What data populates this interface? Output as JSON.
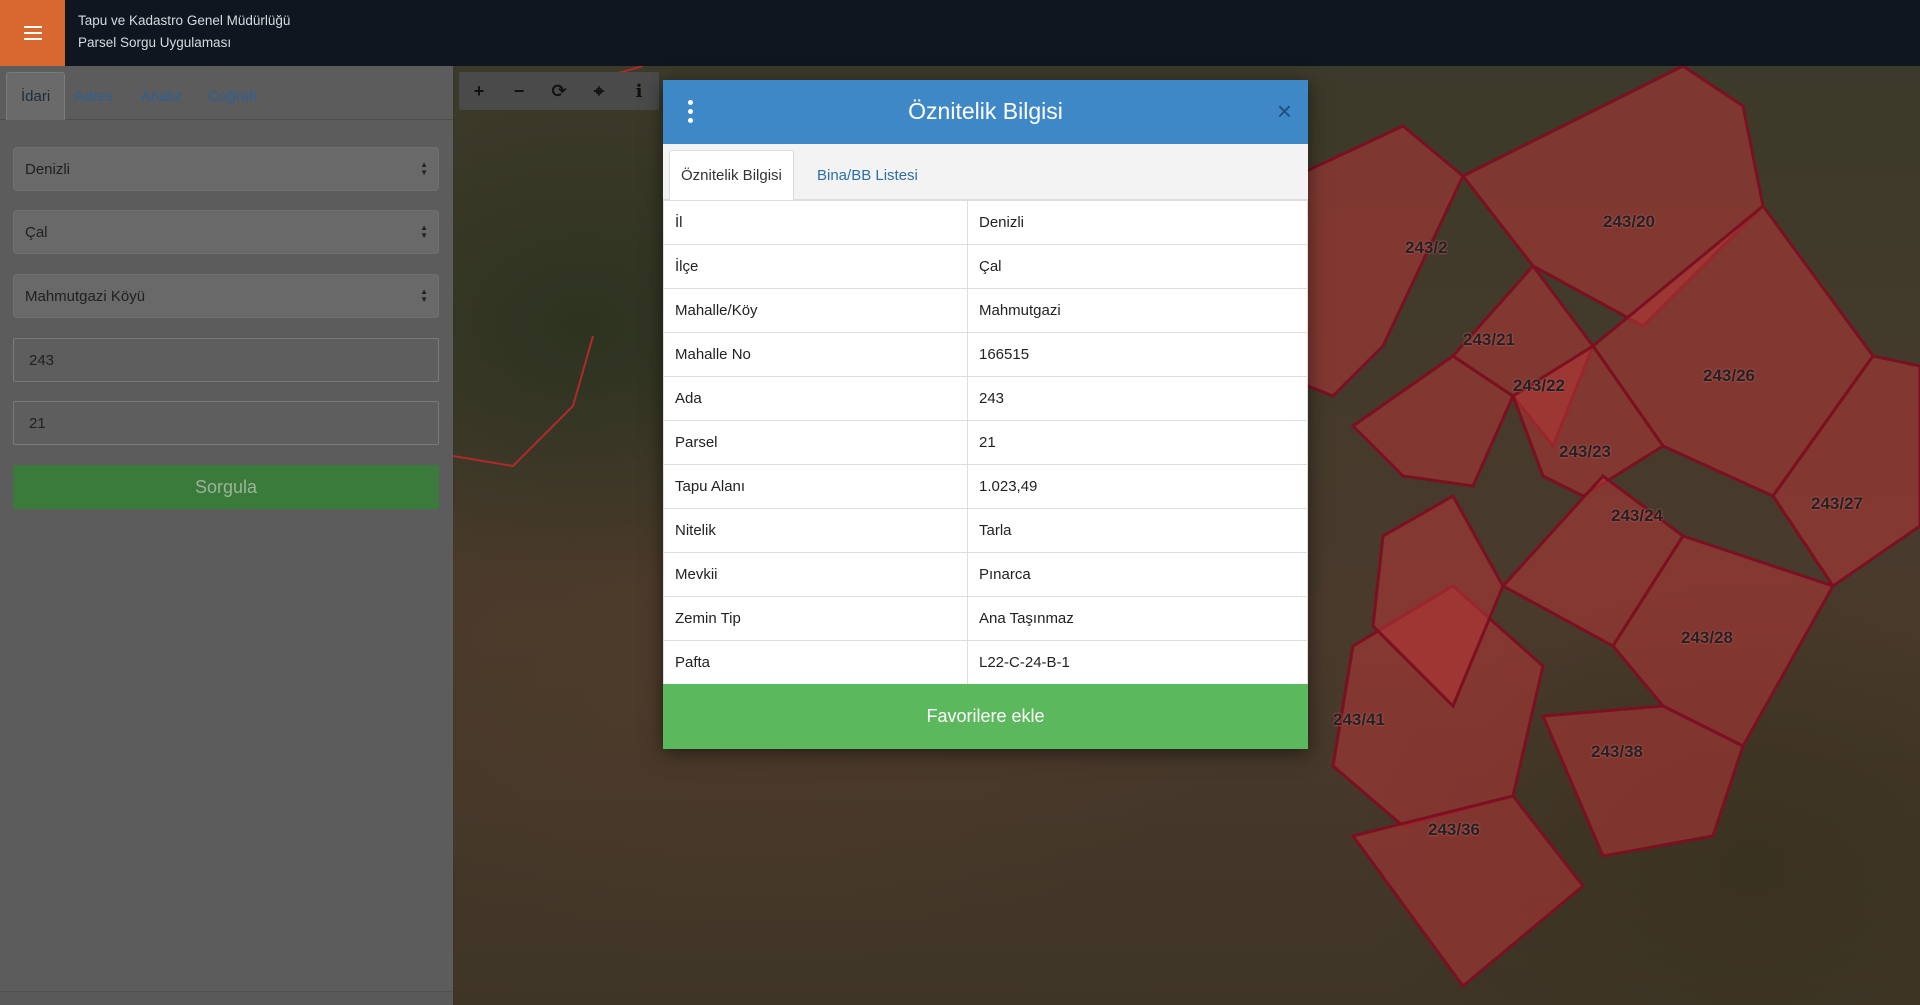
{
  "header": {
    "org_name": "Tapu ve Kadastro Genel Müdürlüğü",
    "app_name": "Parsel Sorgu Uygulaması",
    "menu_icon": "hamburger-icon",
    "accent_color": "#d9682e"
  },
  "sidebar": {
    "tabs": [
      {
        "label": "İdari",
        "active": true
      },
      {
        "label": "Adres",
        "active": false
      },
      {
        "label": "Analiz",
        "active": false
      },
      {
        "label": "Coğrafi",
        "active": false
      }
    ],
    "province_select": "Denizli",
    "district_select": "Çal",
    "neighborhood_select": "Mahmutgazi Köyü",
    "block_input": "243",
    "parcel_input": "21",
    "query_button": "Sorgula"
  },
  "map": {
    "toolbar": [
      "zoom-in-icon",
      "zoom-out-icon",
      "refresh-icon",
      "locate-icon",
      "info-icon"
    ],
    "parcel_labels": [
      "243/2",
      "243/20",
      "243/21",
      "243/22",
      "243/26",
      "243/23",
      "243/24",
      "243/27",
      "243/28",
      "243/41",
      "243/38",
      "243/36"
    ],
    "parcel_color": "#b83a3a"
  },
  "modal": {
    "title": "Öznitelik Bilgisi",
    "tabs": [
      "Öznitelik Bilgisi",
      "Bina/BB Listesi"
    ],
    "rows": [
      {
        "key": "İl",
        "value": "Denizli"
      },
      {
        "key": "İlçe",
        "value": "Çal"
      },
      {
        "key": "Mahalle/Köy",
        "value": "Mahmutgazi"
      },
      {
        "key": "Mahalle No",
        "value": "166515"
      },
      {
        "key": "Ada",
        "value": "243"
      },
      {
        "key": "Parsel",
        "value": "21"
      },
      {
        "key": "Tapu Alanı",
        "value": "1.023,49"
      },
      {
        "key": "Nitelik",
        "value": "Tarla"
      },
      {
        "key": "Mevkii",
        "value": "Pınarca"
      },
      {
        "key": "Zemin Tip",
        "value": "Ana Taşınmaz"
      },
      {
        "key": "Pafta",
        "value": "L22-C-24-B-1"
      }
    ],
    "favorite_button": "Favorilere ekle",
    "header_color": "#3f88c8",
    "button_color": "#5cb85c"
  }
}
